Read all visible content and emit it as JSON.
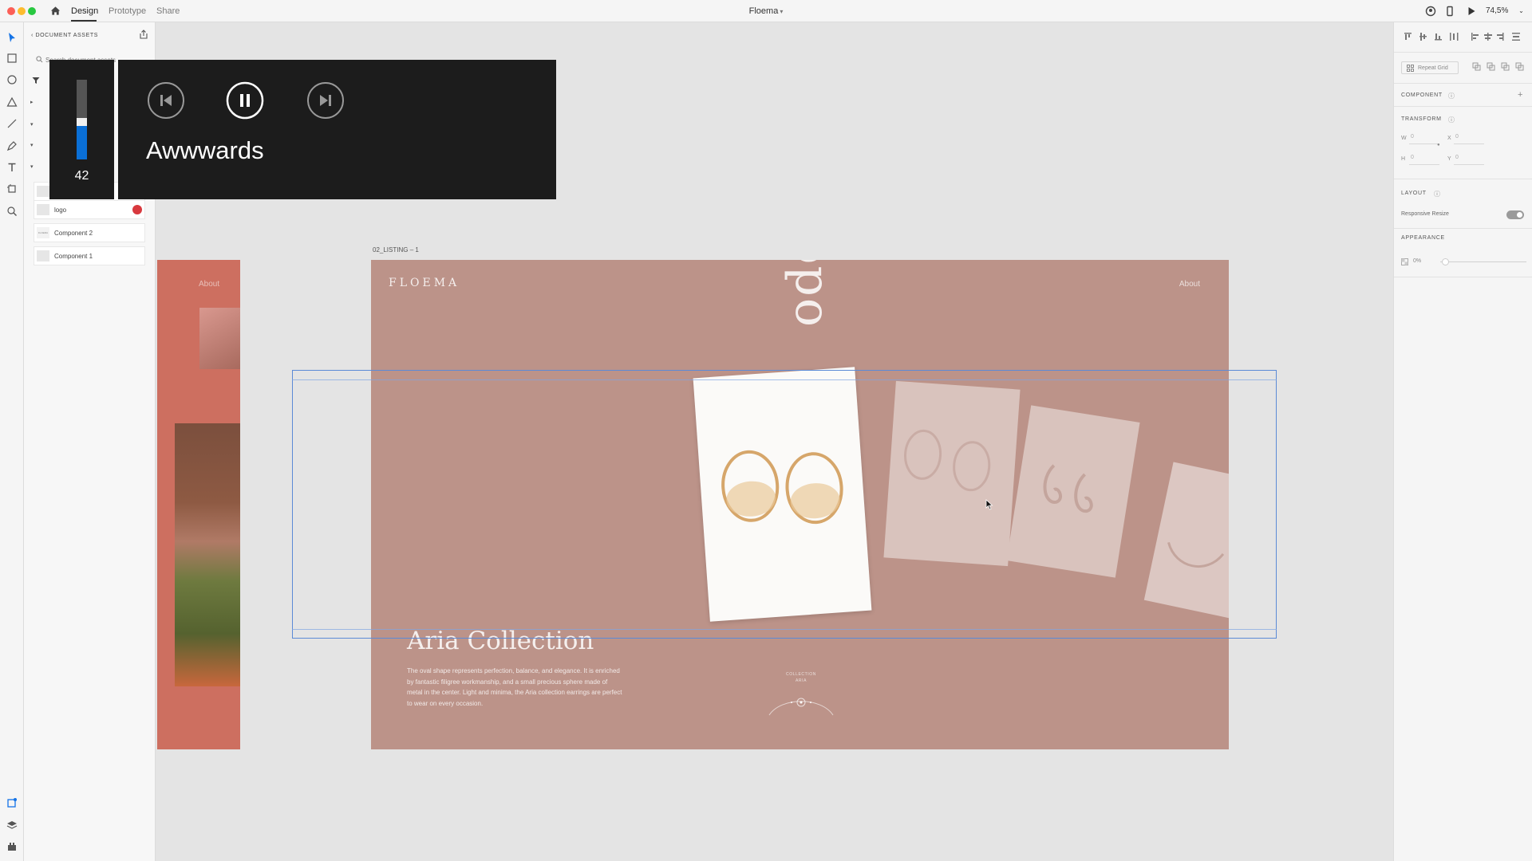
{
  "app": {
    "document_title": "Floema",
    "tabs": [
      "Design",
      "Prototype",
      "Share"
    ],
    "zoom": "74,5%"
  },
  "assets_panel": {
    "header": "DOCUMENT ASSETS",
    "search_placeholder": "Search document assets",
    "components": [
      {
        "name": "logo",
        "thumb": ""
      },
      {
        "name": "Component 2",
        "thumb": "FLOEMA"
      },
      {
        "name": "Component 1",
        "thumb": ""
      }
    ]
  },
  "media_overlay": {
    "volume": 42,
    "volume_level": 0.42,
    "track_title": "Awwwards"
  },
  "canvas": {
    "left_artboard": {
      "nav_about": "About"
    },
    "artboard_label": "02_LISTING – 1",
    "artboard": {
      "logo": "FLOEMA",
      "nav_about": "About",
      "vertical_word": "ode",
      "collection_title": "Aria Collection",
      "description": "The oval shape represents perfection, balance, and elegance. It is enriched by fantastic filigree workmanship, and a small precious sphere made of metal in the center. Light and minima, the Aria collection earrings are perfect to wear on every occasion.",
      "collection_caption": "COLLECTION ARIA"
    }
  },
  "inspector": {
    "repeat_grid_label": "Repeat Grid",
    "component_label": "COMPONENT",
    "transform_label": "TRANSFORM",
    "w_label": "W",
    "w_value": "0",
    "x_label": "X",
    "x_value": "0",
    "h_label": "H",
    "h_value": "0",
    "y_label": "Y",
    "y_value": "0",
    "layout_label": "LAYOUT",
    "responsive_resize_label": "Responsive Resize",
    "appearance_label": "APPEARANCE",
    "opacity_value": "0%"
  }
}
